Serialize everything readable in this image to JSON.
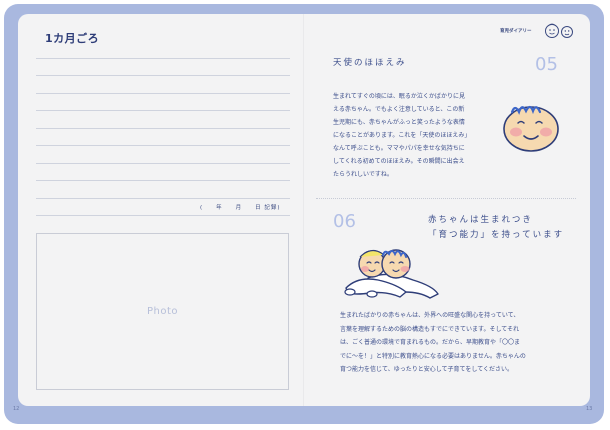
{
  "left_page": {
    "month_title": "1カ月ごろ",
    "record_label": "(　　年　　月　　日 記録)",
    "photo_label": "Photo",
    "page_number": "12"
  },
  "right_page": {
    "brand": "育児ダイアリー",
    "page_number": "13",
    "section_05": {
      "number": "05",
      "title": "天使のほほえみ",
      "body_lines": [
        "生まれてすぐの頃には、眠るか泣くかばかりに見",
        "える赤ちゃん。でもよく注意していると、この新",
        "生児期にも、赤ちゃんがふっと笑ったような表情",
        "になることがあります。これを「天使のほほえみ」",
        "なんて呼ぶことも。ママやパパを幸せな気持ちに",
        "してくれる初めてのほほえみ。その瞬間に出会え",
        "たらうれしいですね。"
      ]
    },
    "section_06": {
      "number": "06",
      "title_lines": [
        "赤ちゃんは生まれつき",
        "「育つ能力」を持っています"
      ],
      "body_lines": [
        "生まれたばかりの赤ちゃんは、外界への旺盛な関心を持っていて、",
        "言葉を理解するための脳の構造もすでにできています。そしてそれ",
        "は、ごく普通の環境で育まれるもの。だから、早期教育や「〇〇ま",
        "でに〜を！」と特別に教育熱心になる必要はありません。赤ちゃんの",
        "育つ能力を信じて、ゆったりと安心して子育てをしてください。"
      ]
    }
  },
  "colors": {
    "cover": "#a9b8df",
    "page": "#f3f3f4",
    "text": "#3d4f8c",
    "accent_number": "#b3c0e6"
  }
}
